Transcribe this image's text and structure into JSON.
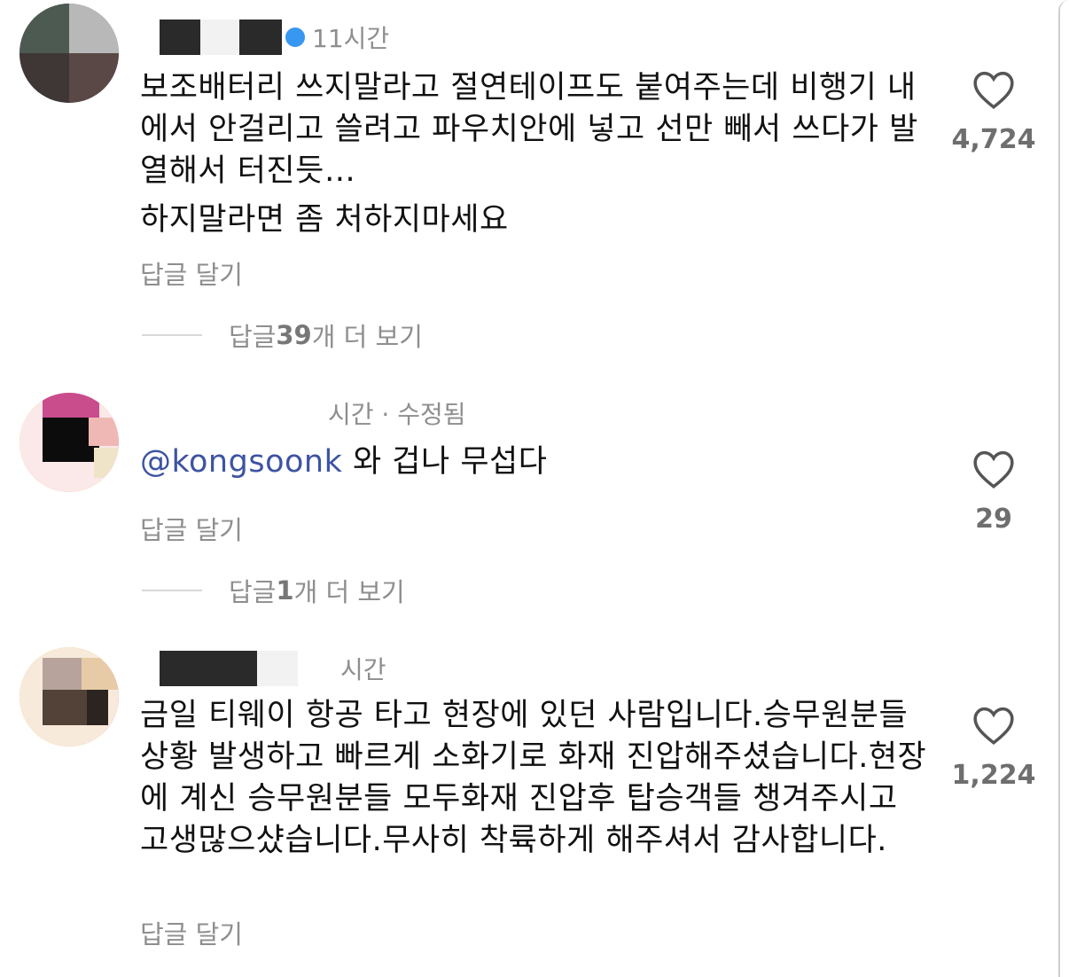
{
  "comments": [
    {
      "time": "11시간",
      "text": "보조배터리 쓰지말라고 절연테이프도 붙여주는데 비행기 내에서 안걸리고 쓸려고 파우치안에 넣고 선만 빼서 쓰다가 발열해서 터진듯…",
      "text2": "하지말라면 좀 처하지마세요",
      "reply_label": "답글 달기",
      "likes": "4,724",
      "more_prefix": "답글 ",
      "more_count": "39",
      "more_suffix": "개 더 보기"
    },
    {
      "time": "시간 · 수정됨",
      "mention": "@kongsoonk",
      "text": " 와 겁나 무섭다",
      "reply_label": "답글 달기",
      "likes": "29",
      "more_prefix": "답글 ",
      "more_count": "1",
      "more_suffix": "개 더 보기"
    },
    {
      "time": "시간",
      "text": "금일 티웨이 항공 타고 현장에 있던 사람입니다.승무원분들 상황 발생하고 빠르게 소화기로 화재 진압해주셨습니다.현장에 계신 승무원분들 모두화재 진압후 탑승객들 챙겨주시고 고생많으샸습니다.무사히 착륙하게 해주셔서 감사합니다.",
      "reply_label": "답글 달기",
      "likes": "1,224"
    }
  ],
  "icons": {
    "like": "heart-outline-icon",
    "verified": "verified-badge-icon"
  },
  "colors": {
    "mention": "#3d53a3",
    "secondary": "#8e8e8e",
    "verified": "#3897f0"
  }
}
